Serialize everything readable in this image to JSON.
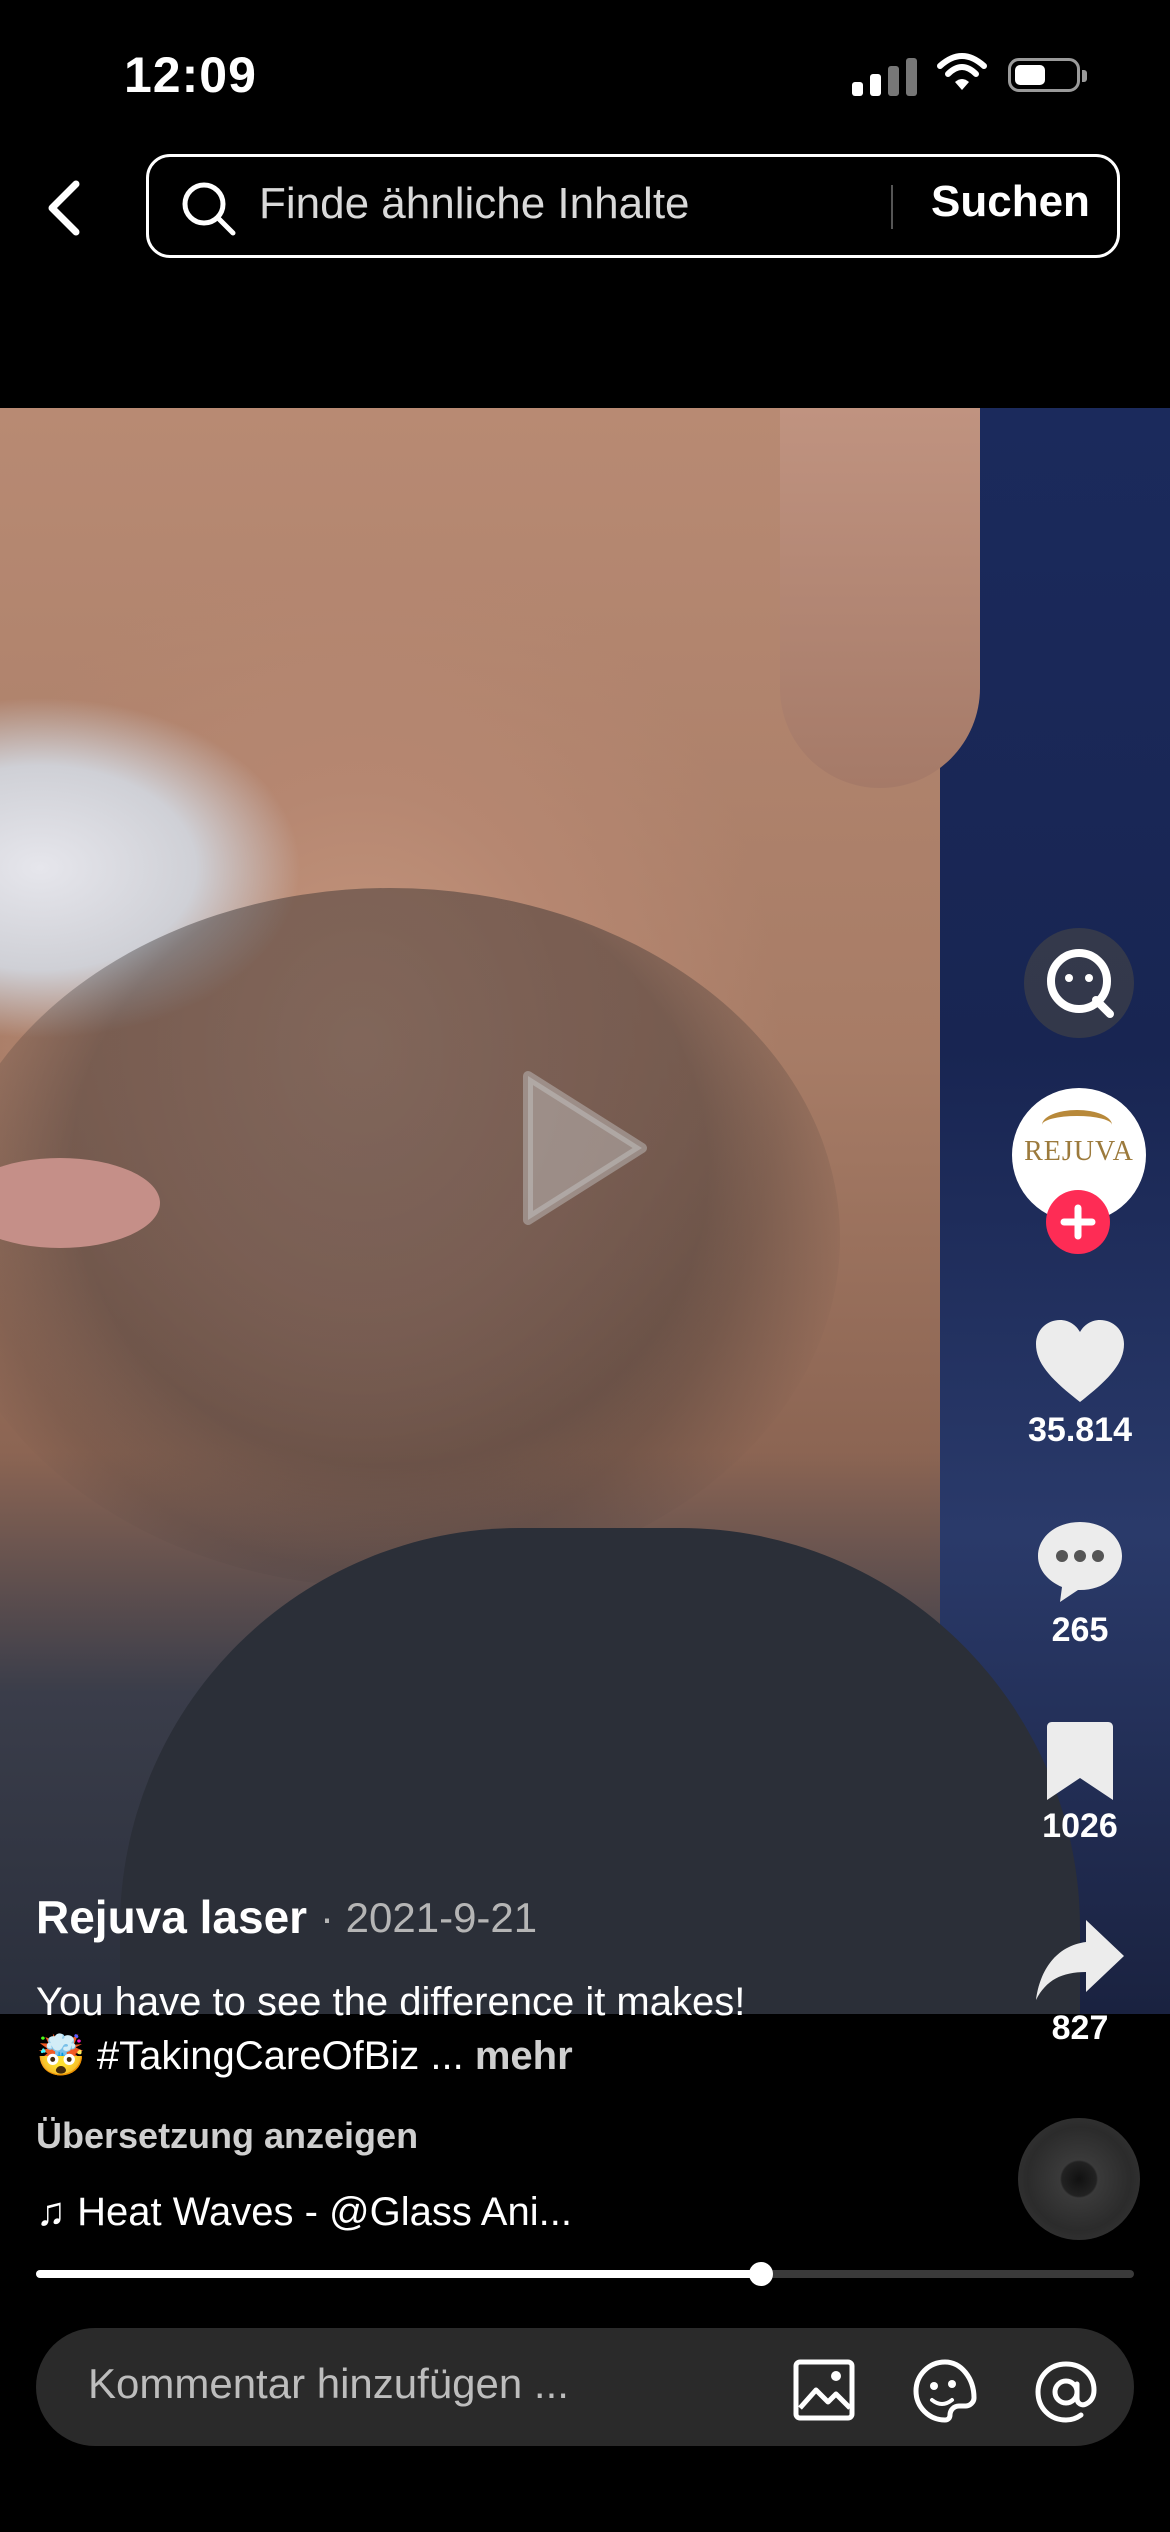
{
  "status_bar": {
    "time": "12:09"
  },
  "search": {
    "placeholder": "Finde ähnliche Inhalte",
    "button_label": "Suchen"
  },
  "video": {
    "playing": false
  },
  "actions": {
    "avatar_label": "REJUVA",
    "likes": "35.814",
    "comments": "265",
    "bookmarks": "1026",
    "shares": "827"
  },
  "post": {
    "author": "Rejuva laser",
    "date": "· 2021-9-21",
    "caption": "You have to see the difference it makes!",
    "hashtags": "🤯 #TakingCareOfBiz ...",
    "more": "mehr",
    "translate": "Übersetzung anzeigen",
    "music": "♫ Heat Waves - @Glass Ani..."
  },
  "progress": {
    "fraction": 0.66
  },
  "comment_bar": {
    "placeholder": "Kommentar hinzufügen ..."
  },
  "colors": {
    "background": "#000000",
    "accent_red": "#fe2c55"
  }
}
